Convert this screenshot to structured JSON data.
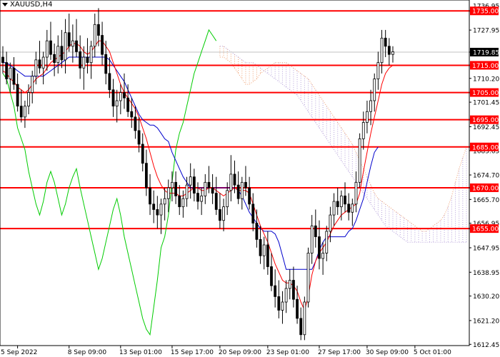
{
  "chart_data": {
    "type": "candlestick",
    "symbol": "XAUUSD,H4",
    "y_range": [
      1612.0,
      1739.0
    ],
    "x_range_bars": [
      0,
      126
    ],
    "y_ticks": [
      1727.95,
      1719.85,
      1710.2,
      1701.45,
      1692.45,
      1683.65,
      1674.7,
      1665.7,
      1656.95,
      1647.95,
      1638.95,
      1630.2,
      1621.2,
      1612.45
    ],
    "top_partial_tick": "1736.95",
    "last_price": "1719.85",
    "horizontal_levels": [
      1735.0,
      1715.0,
      1705.0,
      1695.0,
      1685.0,
      1670.0,
      1655.0
    ],
    "level_labels": [
      "1735.00",
      "1715.00",
      "1705.00",
      "1695.00",
      "1685.00",
      "1670.00",
      "1655.00"
    ],
    "x_ticks": [
      {
        "label": "5 Sep 2022",
        "bar": 4
      },
      {
        "label": "8 Sep 09:00",
        "bar": 18
      },
      {
        "label": "13 Sep 01:00",
        "bar": 32
      },
      {
        "label": "15 Sep 17:00",
        "bar": 46
      },
      {
        "label": "20 Sep 09:00",
        "bar": 59
      },
      {
        "label": "23 Sep 01:00",
        "bar": 72
      },
      {
        "label": "27 Sep 17:00",
        "bar": 86
      },
      {
        "label": "30 Sep 09:00",
        "bar": 99
      },
      {
        "label": "5 Oct 01:00",
        "bar": 112
      }
    ],
    "candles": [
      [
        1718,
        1722,
        1712,
        1716
      ],
      [
        1716,
        1720,
        1708,
        1710
      ],
      [
        1710,
        1716,
        1705,
        1714
      ],
      [
        1714,
        1718,
        1706,
        1708
      ],
      [
        1708,
        1712,
        1698,
        1700
      ],
      [
        1700,
        1706,
        1694,
        1696
      ],
      [
        1696,
        1702,
        1692,
        1700
      ],
      [
        1700,
        1708,
        1697,
        1705
      ],
      [
        1705,
        1713,
        1701,
        1711
      ],
      [
        1711,
        1720,
        1708,
        1717
      ],
      [
        1717,
        1724,
        1712,
        1714
      ],
      [
        1714,
        1720,
        1708,
        1718
      ],
      [
        1718,
        1728,
        1713,
        1724
      ],
      [
        1724,
        1731,
        1717,
        1719
      ],
      [
        1719,
        1723,
        1711,
        1716
      ],
      [
        1716,
        1726,
        1712,
        1722
      ],
      [
        1722,
        1728,
        1714,
        1717
      ],
      [
        1717,
        1732,
        1712,
        1727
      ],
      [
        1727,
        1734,
        1720,
        1722
      ],
      [
        1722,
        1730,
        1716,
        1724
      ],
      [
        1724,
        1732,
        1718,
        1720
      ],
      [
        1720,
        1726,
        1710,
        1714
      ],
      [
        1714,
        1722,
        1706,
        1718
      ],
      [
        1718,
        1725,
        1712,
        1716
      ],
      [
        1716,
        1724,
        1710,
        1722
      ],
      [
        1722,
        1734,
        1718,
        1730
      ],
      [
        1730,
        1736,
        1722,
        1726
      ],
      [
        1726,
        1731,
        1715,
        1719
      ],
      [
        1719,
        1724,
        1708,
        1712
      ],
      [
        1712,
        1718,
        1703,
        1706
      ],
      [
        1706,
        1710,
        1696,
        1700
      ],
      [
        1700,
        1706,
        1694,
        1702
      ],
      [
        1702,
        1708,
        1697,
        1705
      ],
      [
        1705,
        1712,
        1699,
        1703
      ],
      [
        1703,
        1708,
        1696,
        1698
      ],
      [
        1698,
        1703,
        1692,
        1696
      ],
      [
        1696,
        1700,
        1688,
        1691
      ],
      [
        1691,
        1696,
        1683,
        1686
      ],
      [
        1686,
        1690,
        1676,
        1679
      ],
      [
        1679,
        1684,
        1667,
        1670
      ],
      [
        1670,
        1675,
        1660,
        1664
      ],
      [
        1664,
        1669,
        1657,
        1662
      ],
      [
        1662,
        1667,
        1655,
        1660
      ],
      [
        1660,
        1666,
        1653,
        1664
      ],
      [
        1664,
        1670,
        1658,
        1666
      ],
      [
        1666,
        1673,
        1661,
        1670
      ],
      [
        1670,
        1676,
        1665,
        1672
      ],
      [
        1672,
        1676,
        1664,
        1667
      ],
      [
        1667,
        1671,
        1660,
        1663
      ],
      [
        1663,
        1669,
        1659,
        1666
      ],
      [
        1666,
        1674,
        1663,
        1671
      ],
      [
        1671,
        1679,
        1666,
        1674
      ],
      [
        1674,
        1677,
        1665,
        1668
      ],
      [
        1668,
        1672,
        1662,
        1665
      ],
      [
        1665,
        1670,
        1660,
        1667
      ],
      [
        1667,
        1675,
        1664,
        1672
      ],
      [
        1672,
        1678,
        1668,
        1670
      ],
      [
        1670,
        1675,
        1664,
        1668
      ],
      [
        1668,
        1674,
        1660,
        1662
      ],
      [
        1662,
        1668,
        1655,
        1658
      ],
      [
        1658,
        1666,
        1654,
        1663
      ],
      [
        1663,
        1672,
        1660,
        1669
      ],
      [
        1669,
        1682,
        1665,
        1675
      ],
      [
        1675,
        1680,
        1668,
        1671
      ],
      [
        1671,
        1676,
        1664,
        1666
      ],
      [
        1666,
        1674,
        1662,
        1672
      ],
      [
        1672,
        1678,
        1667,
        1670
      ],
      [
        1670,
        1674,
        1662,
        1664
      ],
      [
        1664,
        1668,
        1654,
        1657
      ],
      [
        1657,
        1662,
        1648,
        1651
      ],
      [
        1651,
        1656,
        1642,
        1645
      ],
      [
        1645,
        1652,
        1640,
        1649
      ],
      [
        1649,
        1654,
        1638,
        1641
      ],
      [
        1641,
        1646,
        1632,
        1634
      ],
      [
        1634,
        1640,
        1626,
        1630
      ],
      [
        1630,
        1636,
        1622,
        1625
      ],
      [
        1625,
        1632,
        1620,
        1628
      ],
      [
        1628,
        1636,
        1624,
        1633
      ],
      [
        1633,
        1640,
        1629,
        1636
      ],
      [
        1636,
        1641,
        1626,
        1629
      ],
      [
        1629,
        1634,
        1620,
        1622
      ],
      [
        1622,
        1626,
        1614,
        1616
      ],
      [
        1616,
        1630,
        1614,
        1628
      ],
      [
        1628,
        1648,
        1626,
        1646
      ],
      [
        1646,
        1660,
        1642,
        1656
      ],
      [
        1656,
        1662,
        1648,
        1652
      ],
      [
        1652,
        1658,
        1640,
        1644
      ],
      [
        1644,
        1650,
        1638,
        1646
      ],
      [
        1646,
        1656,
        1643,
        1654
      ],
      [
        1654,
        1663,
        1650,
        1660
      ],
      [
        1660,
        1668,
        1656,
        1665
      ],
      [
        1665,
        1670,
        1660,
        1663
      ],
      [
        1663,
        1669,
        1658,
        1667
      ],
      [
        1667,
        1672,
        1661,
        1664
      ],
      [
        1664,
        1668,
        1658,
        1661
      ],
      [
        1661,
        1666,
        1656,
        1664
      ],
      [
        1664,
        1676,
        1661,
        1672
      ],
      [
        1672,
        1690,
        1670,
        1688
      ],
      [
        1688,
        1698,
        1684,
        1694
      ],
      [
        1694,
        1702,
        1690,
        1698
      ],
      [
        1698,
        1706,
        1693,
        1702
      ],
      [
        1702,
        1712,
        1698,
        1710
      ],
      [
        1710,
        1720,
        1706,
        1716
      ],
      [
        1716,
        1728,
        1712,
        1725
      ],
      [
        1725,
        1728,
        1718,
        1722
      ],
      [
        1722,
        1725,
        1715,
        1719
      ],
      [
        1719,
        1722,
        1716,
        1720
      ]
    ],
    "tenkan": [
      1713,
      1712,
      1710,
      1709,
      1707,
      1706,
      1705,
      1706,
      1708,
      1710,
      1711,
      1712,
      1714,
      1716,
      1717,
      1718,
      1719,
      1720,
      1722,
      1723,
      1723,
      1722,
      1720,
      1719,
      1720,
      1722,
      1724,
      1724,
      1722,
      1720,
      1716,
      1712,
      1708,
      1705,
      1703,
      1701,
      1699,
      1696,
      1692,
      1688,
      1683,
      1678,
      1674,
      1671,
      1669,
      1668,
      1668,
      1668,
      1667,
      1667,
      1668,
      1669,
      1670,
      1670,
      1669,
      1669,
      1670,
      1670,
      1669,
      1668,
      1667,
      1668,
      1669,
      1670,
      1669,
      1669,
      1669,
      1668,
      1664,
      1660,
      1656,
      1653,
      1650,
      1646,
      1642,
      1639,
      1636,
      1635,
      1635,
      1634,
      1632,
      1628,
      1625,
      1630,
      1638,
      1643,
      1646,
      1648,
      1650,
      1653,
      1656,
      1658,
      1660,
      1661,
      1662,
      1663,
      1664,
      1668,
      1676,
      1683,
      1690,
      1696,
      1702,
      1708,
      1712,
      1714,
      1715
    ],
    "kijun": [
      1716,
      1716,
      1715,
      1714,
      1713,
      1712,
      1711,
      1711,
      1711,
      1711,
      1711,
      1711,
      1712,
      1713,
      1714,
      1715,
      1716,
      1717,
      1718,
      1718,
      1718,
      1718,
      1718,
      1718,
      1718,
      1718,
      1718,
      1718,
      1718,
      1717,
      1715,
      1713,
      1711,
      1709,
      1706,
      1703,
      1700,
      1697,
      1695,
      1694,
      1693,
      1693,
      1692,
      1690,
      1688,
      1687,
      1683,
      1680,
      1677,
      1674,
      1672,
      1670,
      1670,
      1670,
      1670,
      1670,
      1670,
      1670,
      1670,
      1670,
      1670,
      1670,
      1670,
      1670,
      1669,
      1667,
      1664,
      1661,
      1659,
      1657,
      1655,
      1654,
      1654,
      1654,
      1653,
      1650,
      1645,
      1640,
      1640,
      1640,
      1640,
      1640,
      1640,
      1640,
      1640,
      1643,
      1647,
      1650,
      1652,
      1652,
      1652,
      1652,
      1652,
      1652,
      1654,
      1655,
      1658,
      1662,
      1666,
      1672,
      1678,
      1683,
      1685
    ],
    "chikou": [
      1712,
      1710,
      1705,
      1700,
      1692,
      1688,
      1684,
      1676,
      1670,
      1664,
      1660,
      1665,
      1672,
      1676,
      1672,
      1666,
      1660,
      1664,
      1670,
      1674,
      1677,
      1670,
      1664,
      1658,
      1652,
      1646,
      1640,
      1644,
      1650,
      1656,
      1662,
      1666,
      1660,
      1652,
      1646,
      1640,
      1634,
      1628,
      1622,
      1618,
      1616,
      1626,
      1636,
      1648,
      1652,
      1660,
      1672,
      1684,
      1690,
      1694,
      1700,
      1706,
      1712,
      1716,
      1720,
      1724,
      1728,
      1726,
      1724
    ],
    "cloud_a": [
      1718,
      1718,
      1717,
      1716,
      1714,
      1712,
      1710,
      1708,
      1708,
      1709,
      1710,
      1712,
      1713,
      1714,
      1715,
      1716,
      1716,
      1716,
      1716,
      1715,
      1714,
      1713,
      1712,
      1711,
      1710,
      1708,
      1706,
      1704,
      1702,
      1700,
      1698,
      1696,
      1694,
      1692,
      1690,
      1688,
      1686,
      1683,
      1680,
      1677,
      1674,
      1671,
      1668,
      1666,
      1665,
      1664,
      1663,
      1662,
      1661,
      1660,
      1659,
      1658,
      1657,
      1656,
      1655,
      1654,
      1654,
      1655,
      1656,
      1657,
      1658,
      1660,
      1663,
      1667,
      1672,
      1677,
      1681,
      1685
    ],
    "cloud_b": [
      1722,
      1722,
      1721,
      1720,
      1719,
      1718,
      1717,
      1716,
      1716,
      1716,
      1715,
      1714,
      1713,
      1712,
      1711,
      1710,
      1709,
      1708,
      1707,
      1706,
      1705,
      1704,
      1702,
      1700,
      1698,
      1696,
      1694,
      1692,
      1690,
      1688,
      1686,
      1684,
      1682,
      1680,
      1678,
      1676,
      1674,
      1672,
      1670,
      1668,
      1666,
      1664,
      1662,
      1660,
      1658,
      1656,
      1655,
      1654,
      1653,
      1652,
      1651,
      1650,
      1650,
      1650,
      1650,
      1650,
      1650,
      1650,
      1650,
      1650,
      1650,
      1650,
      1650,
      1650,
      1650,
      1650,
      1650,
      1650
    ],
    "cloud_start_bar": 59,
    "colors": {
      "bull_body": "#ffffff",
      "bear_body": "#000000",
      "candle_outline": "#000000",
      "level_line": "#ff0000",
      "tenkan": "#ff0000",
      "kijun": "#0000cc",
      "chikou": "#00cc00",
      "cloud_bull": "#b49fd9",
      "cloud_bear": "#f0a070",
      "level_label_bg": "#ff0000",
      "level_label_text": "#ffffff",
      "price_label_bg": "#000000",
      "price_label_text": "#ffffff",
      "axis_text": "#000000",
      "price_line": "#c0c0c0"
    }
  }
}
